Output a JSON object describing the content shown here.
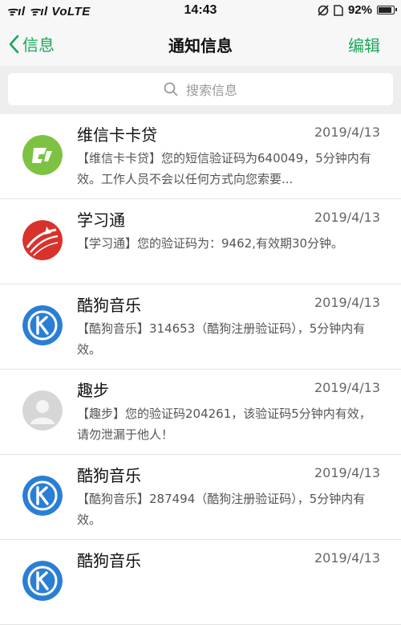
{
  "status_bar": {
    "signal_text": "ᯤıl ᯤıl VoLTE",
    "time": "14:43",
    "battery_percent": "92%",
    "battery_level": 0.92
  },
  "nav": {
    "back_label": "信息",
    "title": "通知信息",
    "edit_label": "编辑"
  },
  "search": {
    "placeholder": "搜索信息"
  },
  "messages": [
    {
      "sender": "维信卡卡贷",
      "date": "2019/4/13",
      "preview": "【维信卡卡贷】您的短信验证码为640049，5分钟内有效。工作人员不会以任何方式向您索要...",
      "avatar": "weixin-kakadai-logo"
    },
    {
      "sender": "学习通",
      "date": "2019/4/13",
      "preview": "【学习通】您的验证码为：9462,有效期30分钟。",
      "avatar": "xuexitong-logo"
    },
    {
      "sender": "酷狗音乐",
      "date": "2019/4/13",
      "preview": "【酷狗音乐】314653（酷狗注册验证码），5分钟内有效。",
      "avatar": "kugou-logo"
    },
    {
      "sender": "趣步",
      "date": "2019/4/13",
      "preview": "【趣步】您的验证码204261，该验证码5分钟内有效，请勿泄漏于他人！",
      "avatar": "default-person"
    },
    {
      "sender": "酷狗音乐",
      "date": "2019/4/13",
      "preview": "【酷狗音乐】287494（酷狗注册验证码），5分钟内有效。",
      "avatar": "kugou-logo"
    },
    {
      "sender": "酷狗音乐",
      "date": "2019/4/13",
      "preview": "",
      "avatar": "kugou-logo"
    }
  ],
  "colors": {
    "accent": "#1aa85a",
    "kugou_blue": "#2a7fd4",
    "kakadai_green": "#7dc242",
    "xuexitong_red": "#d9322d"
  }
}
